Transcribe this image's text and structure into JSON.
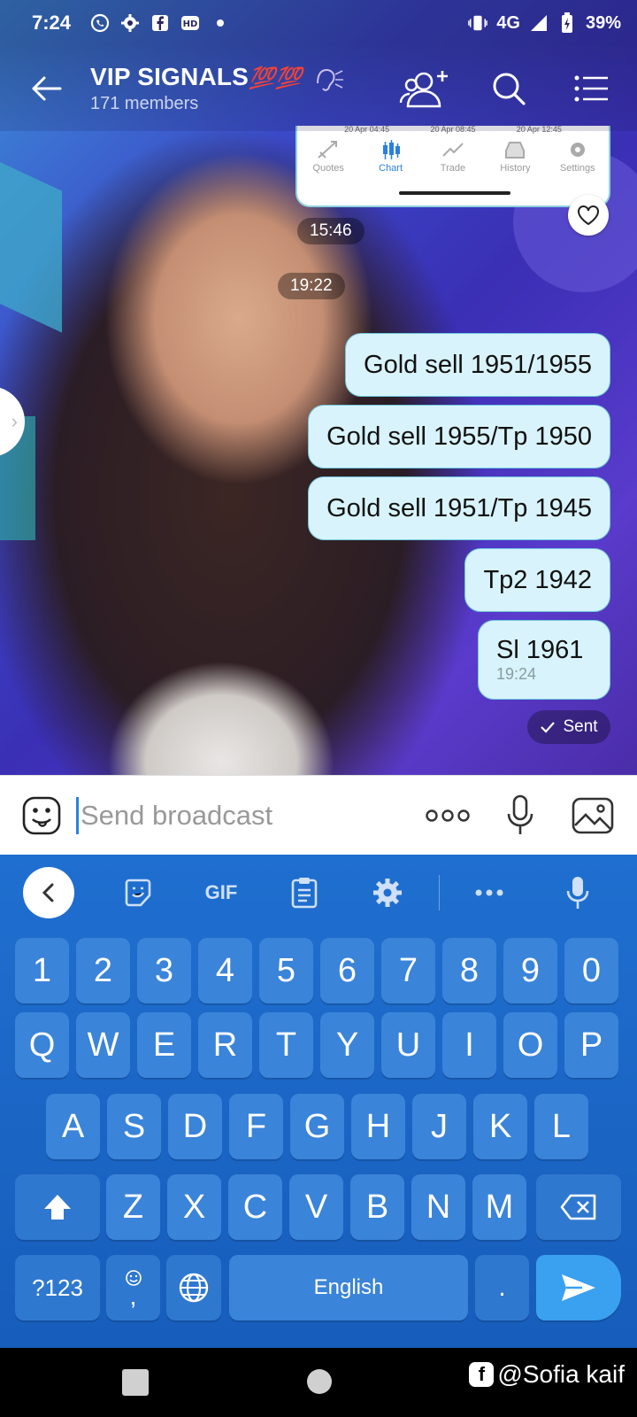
{
  "status_bar": {
    "time": "7:24",
    "network": "4G",
    "battery": "39%"
  },
  "header": {
    "title": "VIP SIGNALS",
    "title_emoji": "💯💯",
    "subtitle": "171 members"
  },
  "shared_image": {
    "dates": [
      "20 Apr 04:45",
      "20 Apr 08:45",
      "20 Apr 12:45"
    ],
    "tabs": [
      "Quotes",
      "Chart",
      "Trade",
      "History",
      "Settings"
    ],
    "active_tab": "Chart"
  },
  "time_pills": [
    "15:46",
    "19:22"
  ],
  "messages": [
    {
      "text": "Gold sell 1951/1955"
    },
    {
      "text": "Gold sell 1955/Tp 1950"
    },
    {
      "text": "Gold sell 1951/Tp 1945"
    },
    {
      "text": "Tp2 1942"
    },
    {
      "text": "Sl 1961",
      "time": "19:24"
    }
  ],
  "sent_status": "Sent",
  "compose": {
    "placeholder": "Send broadcast"
  },
  "keyboard": {
    "gif_label": "GIF",
    "number_row": [
      "1",
      "2",
      "3",
      "4",
      "5",
      "6",
      "7",
      "8",
      "9",
      "0"
    ],
    "row1": [
      "Q",
      "W",
      "E",
      "R",
      "T",
      "Y",
      "U",
      "I",
      "O",
      "P"
    ],
    "row2": [
      "A",
      "S",
      "D",
      "F",
      "G",
      "H",
      "J",
      "K",
      "L"
    ],
    "row3": [
      "Z",
      "X",
      "C",
      "V",
      "B",
      "N",
      "M"
    ],
    "symbols_label": "?123",
    "comma_label": ",",
    "space_label": "English",
    "period_label": "."
  },
  "watermark": "@Sofia kaif",
  "colors": {
    "keyboard_bg": "#1f6fd0",
    "key_bg": "#3a84d9",
    "bubble_bg": "#d8f3fb",
    "accent": "#2a7fe0"
  }
}
